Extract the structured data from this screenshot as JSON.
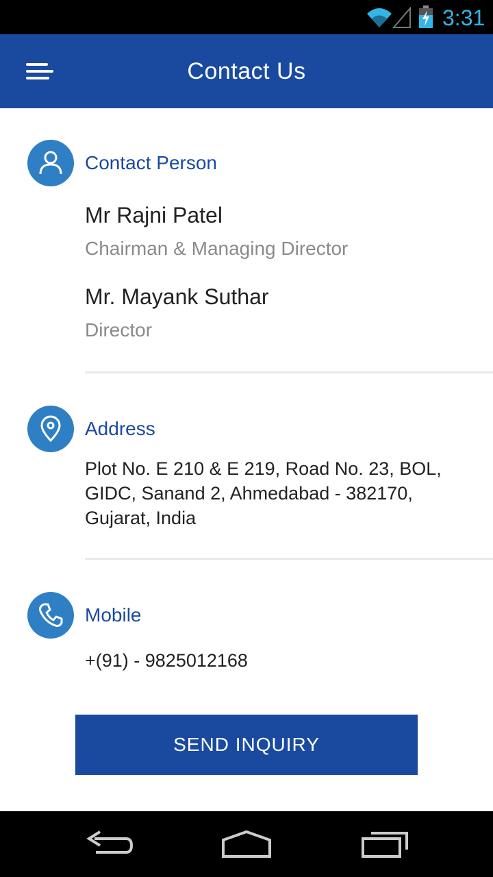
{
  "status_bar": {
    "time": "3:31"
  },
  "header": {
    "title": "Contact Us"
  },
  "contact_person": {
    "label": "Contact Person",
    "people": [
      {
        "name": "Mr Rajni Patel",
        "role": "Chairman & Managing Director"
      },
      {
        "name": "Mr. Mayank Suthar",
        "role": "Director"
      }
    ]
  },
  "address": {
    "label": "Address",
    "lines": [
      "Plot No. E 210 & E 219, Road No. 23, BOL,",
      "GIDC, Sanand 2, Ahmedabad - 382170,",
      "Gujarat, India"
    ]
  },
  "mobile": {
    "label": "Mobile",
    "number": "+(91) - 9825012168"
  },
  "actions": {
    "send_inquiry": "SEND INQUIRY"
  },
  "colors": {
    "primary": "#1a4aa0",
    "icon_bg": "#2e7fc4",
    "clock": "#33b5e5"
  },
  "icons": {
    "menu": "menu-icon",
    "person": "person-icon",
    "location": "location-pin-icon",
    "phone": "phone-icon",
    "wifi": "wifi-icon",
    "signal": "signal-icon",
    "battery": "battery-charging-icon",
    "back": "back-icon",
    "home": "home-icon",
    "recents": "recent-apps-icon"
  }
}
